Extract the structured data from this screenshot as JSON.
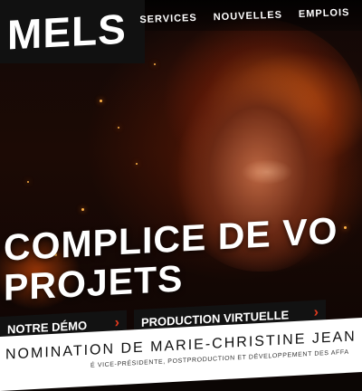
{
  "logo": {
    "text": "MELS"
  },
  "nav": {
    "items": [
      {
        "label": "SERVICES"
      },
      {
        "label": "NOUVELLES"
      },
      {
        "label": "EMPLOIS"
      }
    ]
  },
  "hero": {
    "headline_line1": "COMPLICE DE VO",
    "headline_line2": "PROJETS"
  },
  "buttons": {
    "demo_label": "NOTRE DÉMO",
    "virtual_label": "PRODUCTION VIRTUELLE",
    "chevron": "›"
  },
  "news": {
    "title": "NOMINATION DE MARIE-CHRISTINE JEAN",
    "subtitle": "É VICE-PRÉSIDENTE, POSTPRODUCTION ET DÉVELOPPEMENT DES AFFA"
  },
  "colors": {
    "accent": "#e03a1e",
    "logo_bg": "#111111",
    "button_bg": "#121212"
  }
}
